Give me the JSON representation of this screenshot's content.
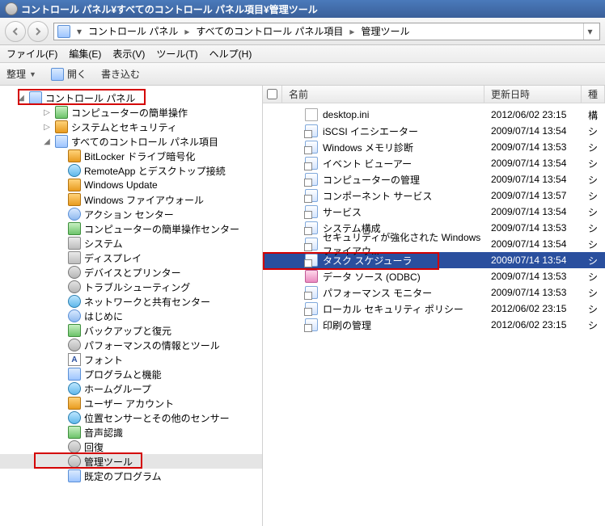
{
  "window": {
    "title": "コントロール パネル¥すべてのコントロール パネル項目¥管理ツール"
  },
  "breadcrumb": {
    "parts": [
      "コントロール パネル",
      "すべてのコントロール パネル項目",
      "管理ツール"
    ]
  },
  "menubar": {
    "file": "ファイル(F)",
    "edit": "編集(E)",
    "view": "表示(V)",
    "tools": "ツール(T)",
    "help": "ヘルプ(H)"
  },
  "toolbar": {
    "organize": "整理",
    "open": "開く",
    "burn": "書き込む"
  },
  "tree": {
    "root": "コントロール パネル",
    "items": [
      {
        "label": "コンピューターの簡単操作",
        "icon": "ic-green"
      },
      {
        "label": "システムとセキュリティ",
        "icon": "ic-shield"
      },
      {
        "label": "すべてのコントロール パネル項目",
        "icon": "ic-generic",
        "expanded": true
      },
      {
        "label": "BitLocker ドライブ暗号化",
        "icon": "ic-shield",
        "indent": 3
      },
      {
        "label": "RemoteApp とデスクトップ接続",
        "icon": "ic-net",
        "indent": 3
      },
      {
        "label": "Windows Update",
        "icon": "ic-shield",
        "indent": 3
      },
      {
        "label": "Windows ファイアウォール",
        "icon": "ic-shield",
        "indent": 3
      },
      {
        "label": "アクション センター",
        "icon": "ic-info",
        "indent": 3
      },
      {
        "label": "コンピューターの簡単操作センター",
        "icon": "ic-green",
        "indent": 3
      },
      {
        "label": "システム",
        "icon": "ic-mon",
        "indent": 3
      },
      {
        "label": "ディスプレイ",
        "icon": "ic-mon",
        "indent": 3
      },
      {
        "label": "デバイスとプリンター",
        "icon": "ic-gear",
        "indent": 3
      },
      {
        "label": "トラブルシューティング",
        "icon": "ic-gear",
        "indent": 3
      },
      {
        "label": "ネットワークと共有センター",
        "icon": "ic-net",
        "indent": 3
      },
      {
        "label": "はじめに",
        "icon": "ic-info",
        "indent": 3
      },
      {
        "label": "バックアップと復元",
        "icon": "ic-green",
        "indent": 3
      },
      {
        "label": "パフォーマンスの情報とツール",
        "icon": "ic-gear",
        "indent": 3
      },
      {
        "label": "フォント",
        "icon": "ic-font",
        "indent": 3
      },
      {
        "label": "プログラムと機能",
        "icon": "ic-generic",
        "indent": 3
      },
      {
        "label": "ホームグループ",
        "icon": "ic-net",
        "indent": 3
      },
      {
        "label": "ユーザー アカウント",
        "icon": "ic-shield",
        "indent": 3
      },
      {
        "label": "位置センサーとその他のセンサー",
        "icon": "ic-net",
        "indent": 3
      },
      {
        "label": "音声認識",
        "icon": "ic-green",
        "indent": 3
      },
      {
        "label": "回復",
        "icon": "ic-gear",
        "indent": 3
      },
      {
        "label": "管理ツール",
        "icon": "ic-gear",
        "indent": 3,
        "selected": true
      },
      {
        "label": "既定のプログラム",
        "icon": "ic-generic",
        "indent": 3
      }
    ]
  },
  "columns": {
    "name": "名前",
    "date": "更新日時",
    "type": "種"
  },
  "files": [
    {
      "name": "desktop.ini",
      "date": "2012/06/02 23:15",
      "type": "構",
      "icon": "ic-file"
    },
    {
      "name": "iSCSI イニシエーター",
      "date": "2009/07/14 13:54",
      "type": "シ",
      "icon": "ic-shortcut"
    },
    {
      "name": "Windows メモリ診断",
      "date": "2009/07/14 13:53",
      "type": "シ",
      "icon": "ic-shortcut"
    },
    {
      "name": "イベント ビューアー",
      "date": "2009/07/14 13:54",
      "type": "シ",
      "icon": "ic-shortcut"
    },
    {
      "name": "コンピューターの管理",
      "date": "2009/07/14 13:54",
      "type": "シ",
      "icon": "ic-shortcut"
    },
    {
      "name": "コンポーネント サービス",
      "date": "2009/07/14 13:57",
      "type": "シ",
      "icon": "ic-shortcut"
    },
    {
      "name": "サービス",
      "date": "2009/07/14 13:54",
      "type": "シ",
      "icon": "ic-shortcut"
    },
    {
      "name": "システム構成",
      "date": "2009/07/14 13:53",
      "type": "シ",
      "icon": "ic-shortcut"
    },
    {
      "name": "セキュリティが強化された Windows ファイアウ...",
      "date": "2009/07/14 13:54",
      "type": "シ",
      "icon": "ic-shortcut"
    },
    {
      "name": "タスク スケジューラ",
      "date": "2009/07/14 13:54",
      "type": "シ",
      "icon": "ic-shortcut",
      "selected": true
    },
    {
      "name": "データ ソース (ODBC)",
      "date": "2009/07/14 13:53",
      "type": "シ",
      "icon": "ic-pink"
    },
    {
      "name": "パフォーマンス モニター",
      "date": "2009/07/14 13:53",
      "type": "シ",
      "icon": "ic-shortcut"
    },
    {
      "name": "ローカル セキュリティ ポリシー",
      "date": "2012/06/02 23:15",
      "type": "シ",
      "icon": "ic-shortcut"
    },
    {
      "name": "印刷の管理",
      "date": "2012/06/02 23:15",
      "type": "シ",
      "icon": "ic-shortcut"
    }
  ]
}
